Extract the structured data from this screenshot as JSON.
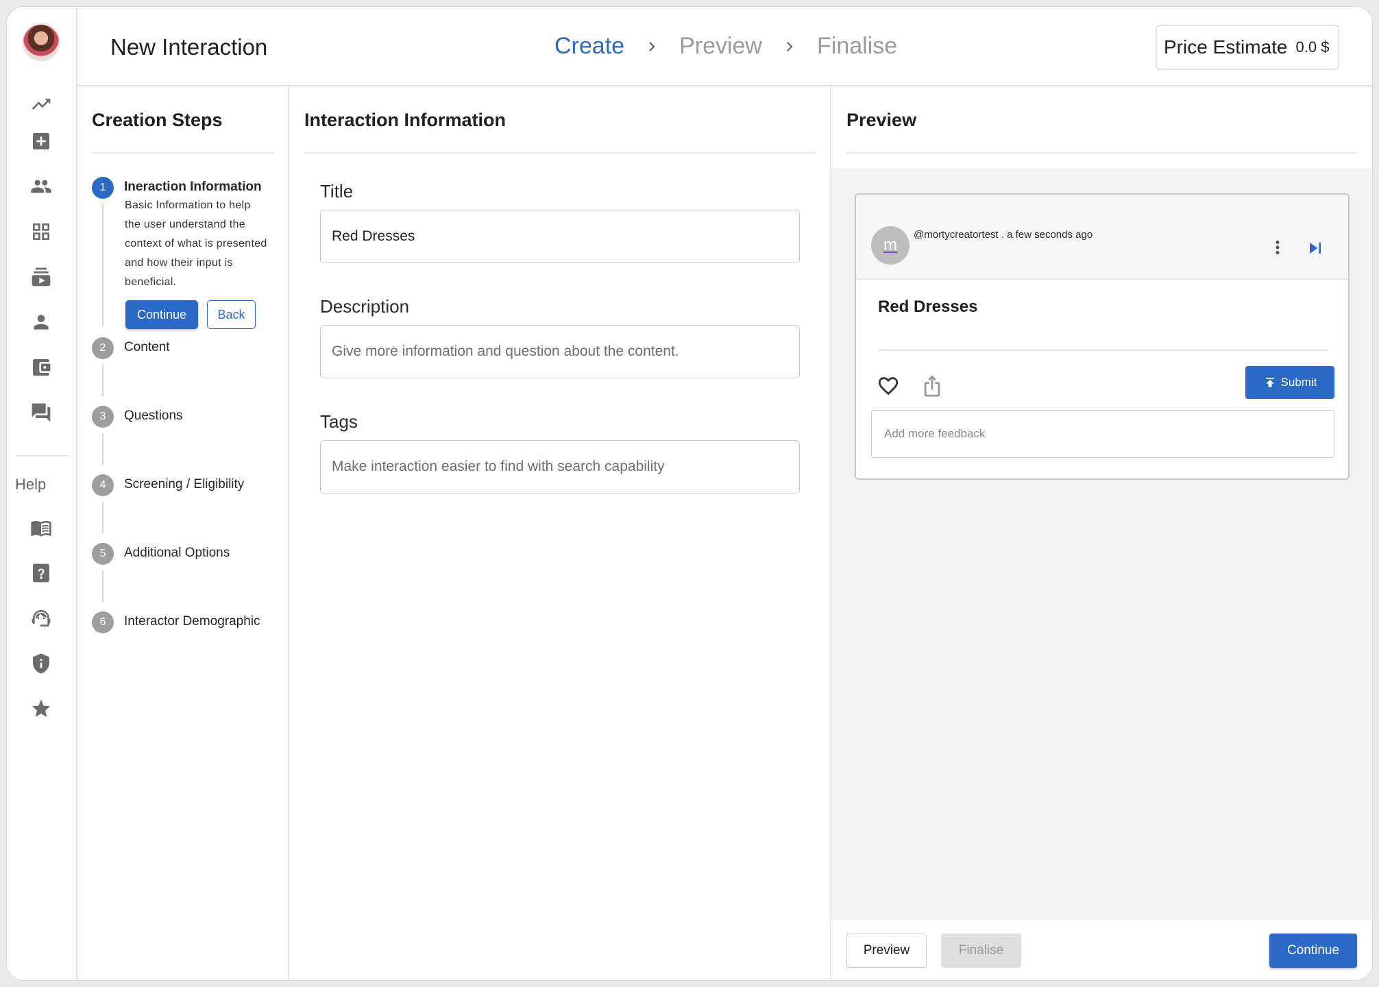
{
  "header": {
    "title": "New Interaction",
    "stepper": [
      "Create",
      "Preview",
      "Finalise"
    ],
    "active_step": "Create",
    "price_label": "Price Estimate",
    "price_value": "0.0 $"
  },
  "sidebar": {
    "icons": [
      "trending-up-icon",
      "add-box-icon",
      "people-icon",
      "dashboard-grid-icon",
      "subscriptions-icon",
      "person-icon",
      "wallet-icon",
      "forum-icon"
    ],
    "help_label": "Help",
    "help_icons": [
      "book-icon",
      "question-icon",
      "support-agent-icon",
      "shield-info-icon",
      "star-icon"
    ]
  },
  "creation_steps": {
    "heading": "Creation Steps",
    "steps": [
      {
        "number": "1",
        "label": "Ineraction Information",
        "active": true
      },
      {
        "number": "2",
        "label": "Content",
        "active": false
      },
      {
        "number": "3",
        "label": "Questions",
        "active": false
      },
      {
        "number": "4",
        "label": "Screening / Eligibility",
        "active": false
      },
      {
        "number": "5",
        "label": "Additional Options",
        "active": false
      },
      {
        "number": "6",
        "label": "Interactor Demographic",
        "active": false
      }
    ],
    "active_description": "Basic Information to help the user understand the context of what is presented and how their input is beneficial.",
    "continue_label": "Continue",
    "back_label": "Back"
  },
  "interaction_info": {
    "heading": "Interaction Information",
    "title_label": "Title",
    "title_value": "Red Dresses",
    "description_label": "Description",
    "description_placeholder": "Give more information and question about the content.",
    "tags_label": "Tags",
    "tags_placeholder": "Make interaction easier to find with search capability"
  },
  "preview": {
    "heading": "Preview",
    "card": {
      "avatar_letter": "m",
      "user_line": "@mortycreatortest . a few seconds ago",
      "title": "Red Dresses",
      "submit_label": "Submit",
      "feedback_placeholder": "Add more feedback"
    }
  },
  "footer": {
    "preview_label": "Preview",
    "finalise_label": "Finalise",
    "continue_label": "Continue"
  },
  "colors": {
    "accent": "#2a69c6",
    "muted_text": "#9a9a9a",
    "preview_background": "#f2f2f2"
  }
}
